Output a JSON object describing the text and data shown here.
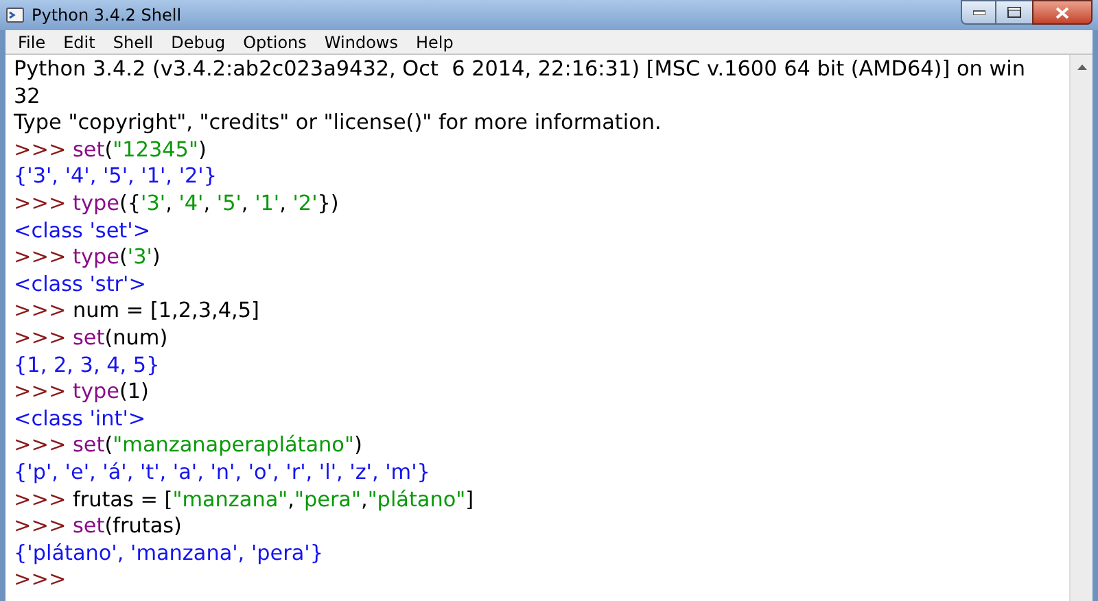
{
  "window": {
    "title": "Python 3.4.2 Shell"
  },
  "menu": [
    "File",
    "Edit",
    "Shell",
    "Debug",
    "Options",
    "Windows",
    "Help"
  ],
  "lines": [
    {
      "segments": [
        {
          "kind": "plain",
          "text": "Python 3.4.2 (v3.4.2:ab2c023a9432, Oct  6 2014, 22:16:31) [MSC v.1600 64 bit (AMD64)] on win"
        }
      ]
    },
    {
      "segments": [
        {
          "kind": "plain",
          "text": "32"
        }
      ]
    },
    {
      "segments": [
        {
          "kind": "plain",
          "text": "Type \"copyright\", \"credits\" or \"license()\" for more information."
        }
      ]
    },
    {
      "segments": [
        {
          "kind": "prompt",
          "text": ">>> "
        },
        {
          "kind": "builtin",
          "text": "set"
        },
        {
          "kind": "plain",
          "text": "("
        },
        {
          "kind": "string",
          "text": "\"12345\""
        },
        {
          "kind": "plain",
          "text": ")"
        }
      ]
    },
    {
      "segments": [
        {
          "kind": "output",
          "text": "{'3', '4', '5', '1', '2'}"
        }
      ]
    },
    {
      "segments": [
        {
          "kind": "prompt",
          "text": ">>> "
        },
        {
          "kind": "builtin",
          "text": "type"
        },
        {
          "kind": "plain",
          "text": "({"
        },
        {
          "kind": "string",
          "text": "'3'"
        },
        {
          "kind": "plain",
          "text": ", "
        },
        {
          "kind": "string",
          "text": "'4'"
        },
        {
          "kind": "plain",
          "text": ", "
        },
        {
          "kind": "string",
          "text": "'5'"
        },
        {
          "kind": "plain",
          "text": ", "
        },
        {
          "kind": "string",
          "text": "'1'"
        },
        {
          "kind": "plain",
          "text": ", "
        },
        {
          "kind": "string",
          "text": "'2'"
        },
        {
          "kind": "plain",
          "text": "})"
        }
      ]
    },
    {
      "segments": [
        {
          "kind": "output",
          "text": "<class 'set'>"
        }
      ]
    },
    {
      "segments": [
        {
          "kind": "prompt",
          "text": ">>> "
        },
        {
          "kind": "builtin",
          "text": "type"
        },
        {
          "kind": "plain",
          "text": "("
        },
        {
          "kind": "string",
          "text": "'3'"
        },
        {
          "kind": "plain",
          "text": ")"
        }
      ]
    },
    {
      "segments": [
        {
          "kind": "output",
          "text": "<class 'str'>"
        }
      ]
    },
    {
      "segments": [
        {
          "kind": "prompt",
          "text": ">>> "
        },
        {
          "kind": "plain",
          "text": "num = [1,2,3,4,5]"
        }
      ]
    },
    {
      "segments": [
        {
          "kind": "prompt",
          "text": ">>> "
        },
        {
          "kind": "builtin",
          "text": "set"
        },
        {
          "kind": "plain",
          "text": "(num)"
        }
      ]
    },
    {
      "segments": [
        {
          "kind": "output",
          "text": "{1, 2, 3, 4, 5}"
        }
      ]
    },
    {
      "segments": [
        {
          "kind": "prompt",
          "text": ">>> "
        },
        {
          "kind": "builtin",
          "text": "type"
        },
        {
          "kind": "plain",
          "text": "(1)"
        }
      ]
    },
    {
      "segments": [
        {
          "kind": "output",
          "text": "<class 'int'>"
        }
      ]
    },
    {
      "segments": [
        {
          "kind": "prompt",
          "text": ">>> "
        },
        {
          "kind": "builtin",
          "text": "set"
        },
        {
          "kind": "plain",
          "text": "("
        },
        {
          "kind": "string",
          "text": "\"manzanaperaplátano\""
        },
        {
          "kind": "plain",
          "text": ")"
        }
      ]
    },
    {
      "segments": [
        {
          "kind": "output",
          "text": "{'p', 'e', 'á', 't', 'a', 'n', 'o', 'r', 'l', 'z', 'm'}"
        }
      ]
    },
    {
      "segments": [
        {
          "kind": "prompt",
          "text": ">>> "
        },
        {
          "kind": "plain",
          "text": "frutas = ["
        },
        {
          "kind": "string",
          "text": "\"manzana\""
        },
        {
          "kind": "plain",
          "text": ","
        },
        {
          "kind": "string",
          "text": "\"pera\""
        },
        {
          "kind": "plain",
          "text": ","
        },
        {
          "kind": "string",
          "text": "\"plátano\""
        },
        {
          "kind": "plain",
          "text": "]"
        }
      ]
    },
    {
      "segments": [
        {
          "kind": "prompt",
          "text": ">>> "
        },
        {
          "kind": "builtin",
          "text": "set"
        },
        {
          "kind": "plain",
          "text": "(frutas)"
        }
      ]
    },
    {
      "segments": [
        {
          "kind": "output",
          "text": "{'plátano', 'manzana', 'pera'}"
        }
      ]
    },
    {
      "segments": [
        {
          "kind": "prompt",
          "text": ">>>"
        }
      ]
    }
  ]
}
